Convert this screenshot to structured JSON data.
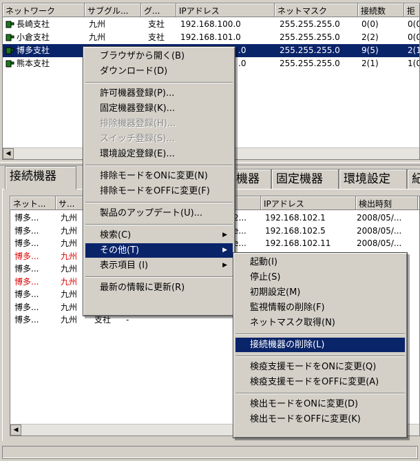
{
  "top_table": {
    "headers": [
      "ネットワーク",
      "サブグル...",
      "グ...",
      "IPアドレス",
      "ネットマスク",
      "接続数",
      "拒"
    ],
    "rows": [
      {
        "network": "長崎支社",
        "sub": "九州",
        "g": "支社",
        "ip": "192.168.100.0",
        "mask": "255.255.255.0",
        "count": "0(0)",
        "rej": "0(0"
      },
      {
        "network": "小倉支社",
        "sub": "九州",
        "g": "支社",
        "ip": "192.168.101.0",
        "mask": "255.255.255.0",
        "count": "2(2)",
        "rej": "0(0"
      },
      {
        "network": "博多支社",
        "sub": "",
        "g": "",
        "ip": ".0",
        "mask": "255.255.255.0",
        "count": "9(5)",
        "rej": "2(1"
      },
      {
        "network": "熊本支社",
        "sub": "",
        "g": "",
        "ip": ".0",
        "mask": "255.255.255.0",
        "count": "2(1)",
        "rej": "1(0"
      }
    ]
  },
  "tabs": [
    "接続機器",
    "機器",
    "固定機器",
    "環境設定",
    "紀"
  ],
  "bottom_table": {
    "headers": [
      "ネット...",
      "サ...",
      "IPアドレス",
      "検出時刻"
    ],
    "rows": [
      {
        "a": "博多...",
        "b": "九州",
        "c": "",
        "d": "",
        "mid": "2...",
        "ip": "192.168.102.1",
        "time": "2008/05/...",
        "red": false
      },
      {
        "a": "博多...",
        "b": "九州",
        "c": "",
        "d": "",
        "mid": "e...",
        "ip": "192.168.102.5",
        "time": "2008/05/...",
        "red": false
      },
      {
        "a": "博多...",
        "b": "九州",
        "c": "",
        "d": "",
        "mid": "e...",
        "ip": "192.168.102.11",
        "time": "2008/05/...",
        "red": false
      },
      {
        "a": "博多...",
        "b": "九州",
        "c": "",
        "d": "",
        "mid": "",
        "ip": "",
        "time": "",
        "red": true
      },
      {
        "a": "博多...",
        "b": "九州",
        "c": "",
        "d": "",
        "mid": "",
        "ip": "",
        "time": "",
        "red": false
      },
      {
        "a": "博多...",
        "b": "九州",
        "c": "",
        "d": "",
        "mid": "",
        "ip": "",
        "time": "",
        "red": true
      },
      {
        "a": "博多...",
        "b": "九州",
        "c": "",
        "d": "",
        "mid": "",
        "ip": "",
        "time": "",
        "red": false
      },
      {
        "a": "博多...",
        "b": "九州",
        "c": "支社",
        "d": "",
        "mid": "",
        "ip": "",
        "time": "",
        "red": false
      },
      {
        "a": "博多...",
        "b": "九州",
        "c": "支社",
        "d": "-",
        "mid": "",
        "ip": "",
        "time": "",
        "red": false
      }
    ]
  },
  "context_menu": {
    "items": [
      {
        "label": "ブラウザから開く(B)",
        "disabled": false
      },
      {
        "label": "ダウンロード(D)",
        "disabled": false
      },
      {
        "sep": true
      },
      {
        "label": "許可機器登録(P)...",
        "disabled": false
      },
      {
        "label": "固定機器登録(K)...",
        "disabled": false
      },
      {
        "label": "排除機器登録(H)...",
        "disabled": true
      },
      {
        "label": "スイッチ登録(S)...",
        "disabled": true
      },
      {
        "label": "環境設定登録(E)...",
        "disabled": false
      },
      {
        "sep": true
      },
      {
        "label": "排除モードをONに変更(N)",
        "disabled": false
      },
      {
        "label": "排除モードをOFFに変更(F)",
        "disabled": false
      },
      {
        "sep": true
      },
      {
        "label": "製品のアップデート(U)...",
        "disabled": false
      },
      {
        "sep": true
      },
      {
        "label": "検索(C)",
        "submenu": true
      },
      {
        "label": "その他(T)",
        "submenu": true,
        "highlighted": true
      },
      {
        "label": "表示項目 (I)",
        "submenu": true
      },
      {
        "sep": true
      },
      {
        "label": "最新の情報に更新(R)",
        "disabled": false
      }
    ]
  },
  "submenu": {
    "items": [
      {
        "label": "起動(I)"
      },
      {
        "label": "停止(S)"
      },
      {
        "label": "初期設定(M)"
      },
      {
        "label": "監視情報の削除(F)"
      },
      {
        "label": "ネットマスク取得(N)"
      },
      {
        "sep": true
      },
      {
        "label": "接続機器の削除(L)",
        "highlighted": true
      },
      {
        "sep": true
      },
      {
        "label": "検疫支援モードをONに変更(Q)"
      },
      {
        "label": "検疫支援モードをOFFに変更(A)"
      },
      {
        "sep": true
      },
      {
        "label": "検出モードをONに変更(D)"
      },
      {
        "label": "検出モードをOFFに変更(K)"
      }
    ]
  },
  "colors": {
    "selection": "#0a246a",
    "red_text": "#e00000",
    "face": "#d4d0c8"
  }
}
